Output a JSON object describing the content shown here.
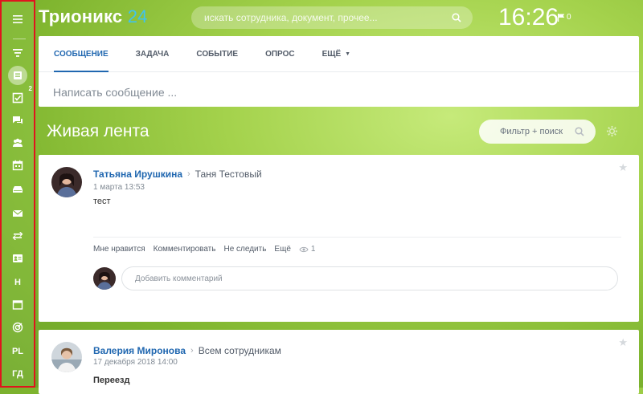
{
  "app": {
    "logo_text": "Трионикс",
    "logo_number": "24"
  },
  "header": {
    "search_placeholder": "искать сотрудника, документ, прочее...",
    "time": "16:26",
    "notifications_count": "0"
  },
  "sidebar": {
    "items": [
      {
        "icon": "menu-icon"
      },
      {
        "icon": "filter-icon"
      },
      {
        "icon": "feed-icon",
        "active": true
      },
      {
        "icon": "tasks-icon",
        "badge": "2"
      },
      {
        "icon": "chat-icon"
      },
      {
        "icon": "people-icon"
      },
      {
        "icon": "calendar-icon"
      },
      {
        "icon": "drive-icon"
      },
      {
        "icon": "mail-icon"
      },
      {
        "icon": "sync-icon"
      },
      {
        "icon": "contact-icon"
      },
      {
        "label": "Н"
      },
      {
        "icon": "window-icon"
      },
      {
        "icon": "target-icon"
      },
      {
        "label": "PL"
      },
      {
        "label": "ГД"
      }
    ]
  },
  "composer": {
    "tabs": [
      "СООБЩЕНИЕ",
      "ЗАДАЧА",
      "СОБЫТИЕ",
      "ОПРОС",
      "ЕЩЁ"
    ],
    "placeholder": "Написать сообщение ..."
  },
  "feed": {
    "title": "Живая лента",
    "filter_placeholder": "Фильтр + поиск"
  },
  "posts": [
    {
      "author": "Татьяна Ирушкина",
      "target": "Таня Тестовый",
      "date": "1 марта 13:53",
      "text": "тест",
      "actions": [
        "Мне нравится",
        "Комментировать",
        "Не следить",
        "Ещё"
      ],
      "views": "1",
      "comment_placeholder": "Добавить комментарий"
    },
    {
      "author": "Валерия Миронова",
      "target": "Всем сотрудникам",
      "date": "17 декабря 2018 14:00",
      "text": "Переезд"
    }
  ],
  "colors": {
    "accent": "#2067b0",
    "logo_number": "#3fc3ee",
    "highlight_border": "#e0141e"
  }
}
